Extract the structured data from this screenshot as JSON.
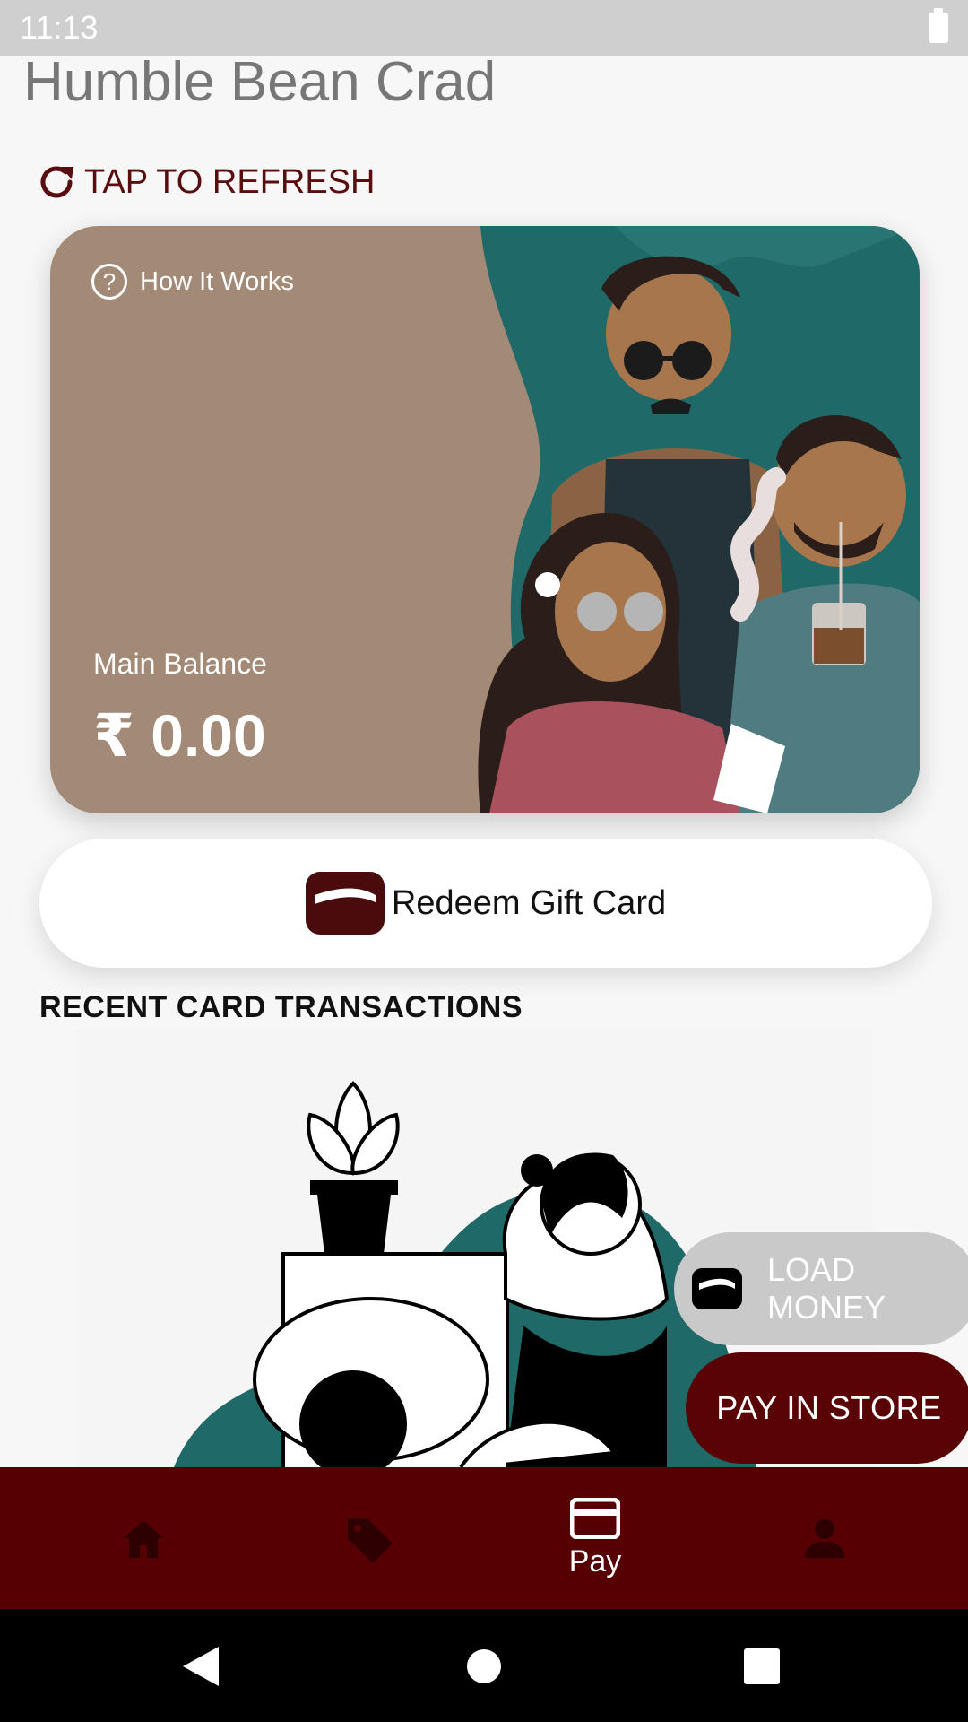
{
  "status_bar": {
    "time": "11:13"
  },
  "header": {
    "title": "Humble Bean Crad",
    "refresh_label": "TAP TO REFRESH"
  },
  "card": {
    "how_it_works": "How It Works",
    "balance_label": "Main Balance",
    "balance_value": "₹ 0.00"
  },
  "actions": {
    "redeem_label": "Redeem Gift Card",
    "load_money_label": "LOAD MONEY",
    "pay_in_store_label": "PAY IN STORE"
  },
  "transactions": {
    "title": "RECENT CARD TRANSACTIONS"
  },
  "bottom_nav": {
    "active": "pay",
    "items": [
      {
        "id": "home",
        "icon": "home-icon",
        "label": ""
      },
      {
        "id": "offers",
        "icon": "tag-icon",
        "label": ""
      },
      {
        "id": "pay",
        "icon": "card-icon",
        "label": "Pay"
      },
      {
        "id": "profile",
        "icon": "person-icon",
        "label": ""
      }
    ]
  },
  "colors": {
    "brand_primary": "#560004",
    "button_dark": "#5a0305",
    "card_bg": "#a38a76",
    "teal": "#1f6a68"
  }
}
